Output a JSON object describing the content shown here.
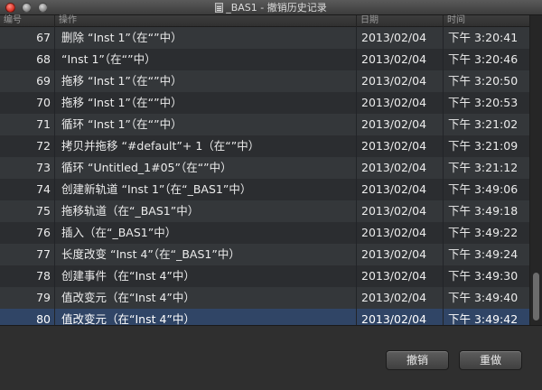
{
  "window": {
    "title": "_BAS1 - 撤销历史记录"
  },
  "columns": {
    "number": "编号",
    "operation": "操作",
    "date": "日期",
    "time": "时间"
  },
  "rows": [
    {
      "number": "67",
      "operation": "删除 “Inst 1”（在“”中）",
      "date": "2013/02/04",
      "time": "下午 3:20:41"
    },
    {
      "number": "68",
      "operation": " “Inst 1”（在“”中）",
      "date": "2013/02/04",
      "time": "下午 3:20:46"
    },
    {
      "number": "69",
      "operation": "拖移 “Inst 1”（在“”中）",
      "date": "2013/02/04",
      "time": "下午 3:20:50"
    },
    {
      "number": "70",
      "operation": "拖移 “Inst 1”（在“”中）",
      "date": "2013/02/04",
      "time": "下午 3:20:53"
    },
    {
      "number": "71",
      "operation": "循环 “Inst 1”（在“”中）",
      "date": "2013/02/04",
      "time": "下午 3:21:02"
    },
    {
      "number": "72",
      "operation": "拷贝并拖移 “#default”+ 1（在“”中）",
      "date": "2013/02/04",
      "time": "下午 3:21:09"
    },
    {
      "number": "73",
      "operation": "循环 “Untitled_1#05”（在“”中）",
      "date": "2013/02/04",
      "time": "下午 3:21:12"
    },
    {
      "number": "74",
      "operation": "创建新轨道 “Inst 1”（在“_BAS1”中）",
      "date": "2013/02/04",
      "time": "下午 3:49:06"
    },
    {
      "number": "75",
      "operation": "拖移轨道（在“_BAS1”中）",
      "date": "2013/02/04",
      "time": "下午 3:49:18"
    },
    {
      "number": "76",
      "operation": "插入（在“_BAS1”中）",
      "date": "2013/02/04",
      "time": "下午 3:49:22"
    },
    {
      "number": "77",
      "operation": "长度改变 “Inst 4”（在“_BAS1”中）",
      "date": "2013/02/04",
      "time": "下午 3:49:24"
    },
    {
      "number": "78",
      "operation": "创建事件（在“Inst 4”中）",
      "date": "2013/02/04",
      "time": "下午 3:49:30"
    },
    {
      "number": "79",
      "operation": "值改变元（在“Inst 4”中）",
      "date": "2013/02/04",
      "time": "下午 3:49:40"
    },
    {
      "number": "80",
      "operation": "值改变元（在“Inst 4”中）",
      "date": "2013/02/04",
      "time": "下午 3:49:42",
      "selected": true
    }
  ],
  "buttons": {
    "undo": "撤销",
    "redo": "重做"
  },
  "colors": {
    "selection": "#304566",
    "background": "#2e3033"
  }
}
